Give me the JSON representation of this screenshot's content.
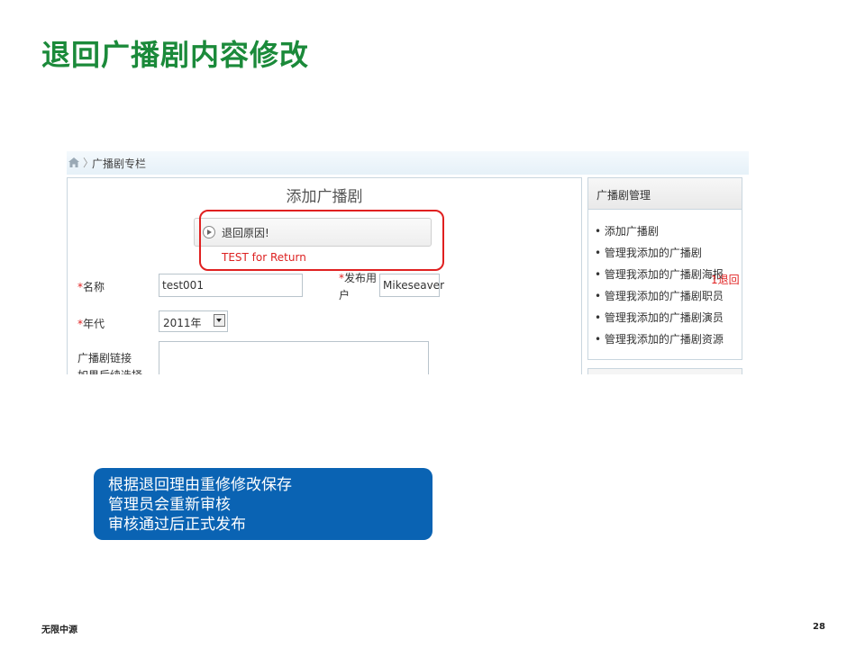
{
  "slide": {
    "title": "退回广播剧内容修改"
  },
  "breadcrumb": {
    "current": "广播剧专栏",
    "separator": "〉"
  },
  "form": {
    "title": "添加广播剧",
    "return_reason_label": "退回原因!",
    "return_reason_text": "TEST for Return",
    "required_marker": "*",
    "name_label": "名称",
    "name_value": "test001",
    "publisher_label_1": "发布用",
    "publisher_label_2": "户",
    "publisher_value": "Mikeseaver",
    "year_label": "年代",
    "year_value": "2011年",
    "link_label": "广播剧链接",
    "link_hint": "如果后续选择"
  },
  "sidebar": {
    "title": "广播剧管理",
    "items": [
      "添加广播剧",
      "管理我添加的广播剧",
      "管理我添加的广播剧海报",
      "管理我添加的广播剧职员",
      "管理我添加的广播剧演员",
      "管理我添加的广播剧资源"
    ],
    "badge": "1退回"
  },
  "note": {
    "lines": [
      "根据退回理由重修修改保存",
      "管理员会重新审核",
      "审核通过后正式发布"
    ]
  },
  "footer": {
    "left": "无限中源",
    "page": "28"
  },
  "colors": {
    "title": "#1b8a3a",
    "highlight": "#e02020",
    "note_bg": "#0a63b3"
  }
}
